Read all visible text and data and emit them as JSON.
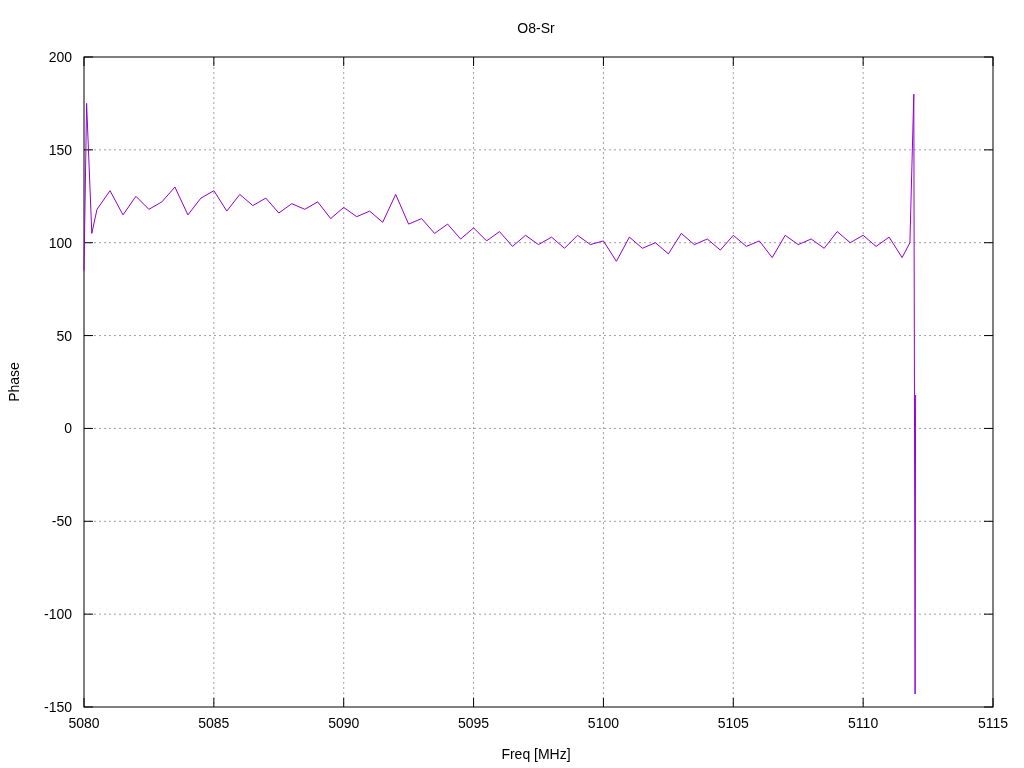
{
  "chart_data": {
    "type": "line",
    "title": "O8-Sr",
    "xlabel": "Freq [MHz]",
    "ylabel": "Phase",
    "x": [
      5080,
      5080.1,
      5080.3,
      5080.5,
      5081,
      5081.5,
      5082,
      5082.5,
      5083,
      5083.5,
      5084,
      5084.5,
      5085,
      5085.5,
      5086,
      5086.5,
      5087,
      5087.5,
      5088,
      5088.5,
      5089,
      5089.5,
      5090,
      5090.5,
      5091,
      5091.5,
      5092,
      5092.5,
      5093,
      5093.5,
      5094,
      5094.5,
      5095,
      5095.5,
      5096,
      5096.5,
      5097,
      5097.5,
      5098,
      5098.5,
      5099,
      5099.5,
      5100,
      5100.5,
      5101,
      5101.5,
      5102,
      5102.5,
      5103,
      5103.5,
      5104,
      5104.5,
      5105,
      5105.5,
      5106,
      5106.5,
      5107,
      5107.5,
      5108,
      5108.5,
      5109,
      5109.5,
      5110,
      5110.5,
      5111,
      5111.5,
      5111.8,
      5111.95,
      5112,
      5112.02
    ],
    "series": [
      {
        "color": "#9400d3",
        "values": [
          85,
          175,
          105,
          118,
          128,
          115,
          125,
          118,
          122,
          130,
          115,
          124,
          128,
          117,
          126,
          120,
          124,
          116,
          121,
          118,
          122,
          113,
          119,
          114,
          117,
          111,
          126,
          110,
          113,
          105,
          110,
          102,
          108,
          101,
          106,
          98,
          104,
          99,
          103,
          97,
          104,
          99,
          101,
          90,
          103,
          97,
          100,
          94,
          105,
          99,
          102,
          96,
          104,
          98,
          101,
          92,
          104,
          99,
          102,
          97,
          106,
          100,
          104,
          98,
          103,
          92,
          100,
          180,
          -143,
          18
        ]
      }
    ],
    "xlim": [
      5080,
      5115
    ],
    "ylim": [
      -150,
      200
    ],
    "xticks": [
      5080,
      5085,
      5090,
      5095,
      5100,
      5105,
      5110,
      5115
    ],
    "yticks": [
      -150,
      -100,
      -50,
      0,
      50,
      100,
      150,
      200
    ],
    "grid": true
  }
}
